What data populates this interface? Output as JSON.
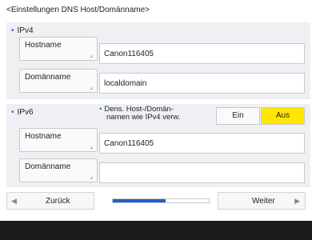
{
  "page": {
    "title": "<Einstellungen DNS Host/Domänname>"
  },
  "ipv4": {
    "label": "IPv4",
    "hostname_button": "Hostname",
    "hostname_value": "Canon116405",
    "domain_button": "Domänname",
    "domain_value": "localdomain"
  },
  "ipv6": {
    "label": "IPv6",
    "note_line1": "Dens. Host-/Domän-",
    "note_line2": "namen wie IPv4 verw.",
    "toggle_on": "Ein",
    "toggle_off": "Aus",
    "toggle_selected": "Aus",
    "hostname_button": "Hostname",
    "hostname_value": "Canon116405",
    "domain_button": "Domänname",
    "domain_value": ""
  },
  "nav": {
    "back_label": "Zurück",
    "next_label": "Weiter",
    "progress_fraction": 0.55
  },
  "icons": {
    "bullet": "dot-bullet-icon",
    "back": "left-arrow-icon",
    "next": "right-arrow-icon",
    "field_corner": "corner-arrow-icon"
  },
  "colors": {
    "accent_blue": "#1f63c8",
    "selected_yellow": "#ffe600",
    "section_bg": "#eef0f4",
    "footer": "#1c1c1c"
  }
}
